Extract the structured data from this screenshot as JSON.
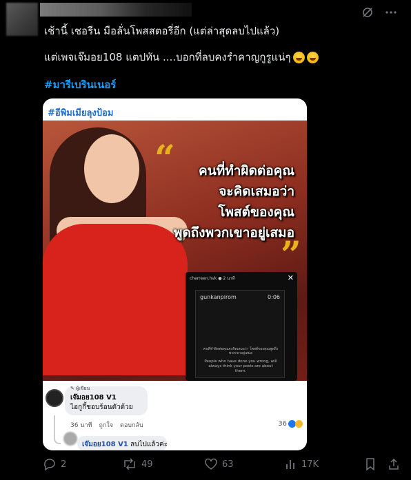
{
  "post": {
    "line1": "เช้านี้  เชอรีน มือลั่นโพสสตอรี่อีก  (แต่ล่าสุดลบไปแล้ว)",
    "line2": "แต่เพจเจ๊มอย108 แตปทัน ....บอกที่ลบคงรำคาญกูรูแน่ๆ",
    "hashtag": "#มารีเบรินเนอร์"
  },
  "card": {
    "tag": "#อีพิมเมียลุงป้อม",
    "quote_lines": [
      "คนที่ทำผิดต่อคุณ",
      "จะคิดเสมอว่า",
      "โพสต์ของคุณ",
      "พูดถึงพวกเขาอยู่เสมอ"
    ],
    "story": {
      "header": "cherreen.hvk ● 2 นาที",
      "user": "gunkanpirom",
      "time": "0:06",
      "thai_caption": "คนที่ทำผิดต่อคุณจะคิดเสมอว่า โพสต์ของคุณพูดถึงพวกเขาอยู่เสมอ",
      "en_caption": "People who have done you wrong, will always think your posts are about them."
    }
  },
  "comment": {
    "badge": "ผู้เขียน",
    "name": "เจ๊มอย108 V1",
    "text": "ไอกูกี้ชอบร้อนตัวด้วย",
    "time": "36 นาที",
    "like": "ถูกใจ",
    "reply": "ตอบกลับ",
    "reactions": "36",
    "reply_name": "เจ๊มอย108 V1",
    "reply_text": "ลบไปแล้วค่ะ"
  },
  "actions": {
    "replies": "2",
    "reposts": "49",
    "likes": "63",
    "views": "17K"
  },
  "icons": [
    "grok-icon",
    "more-icon",
    "reply-icon",
    "repost-icon",
    "like-icon",
    "views-icon",
    "bookmark-icon",
    "share-icon"
  ]
}
